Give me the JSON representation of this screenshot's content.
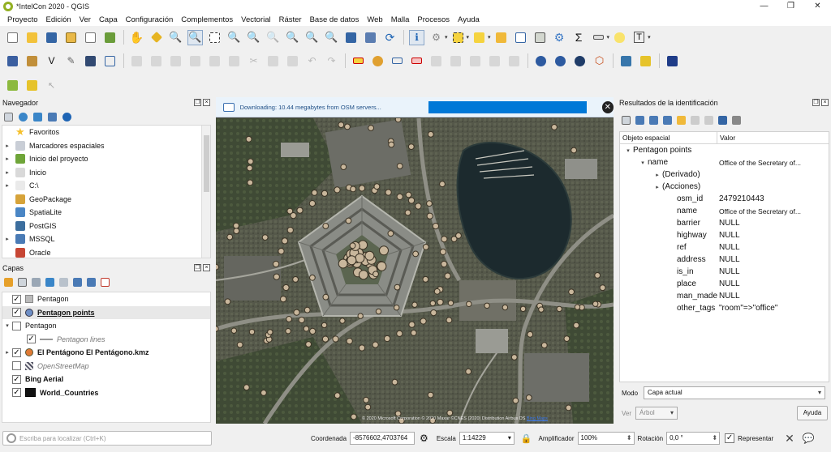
{
  "window": {
    "title": "*IntelCon 2020 - QGIS"
  },
  "menu": [
    "Proyecto",
    "Edición",
    "Ver",
    "Capa",
    "Configuración",
    "Complementos",
    "Vectorial",
    "Ráster",
    "Base de datos",
    "Web",
    "Malla",
    "Procesos",
    "Ayuda"
  ],
  "navigator": {
    "title": "Navegador",
    "items": [
      {
        "label": "Favoritos",
        "icon": "star-icon",
        "expand": false
      },
      {
        "label": "Marcadores espaciales",
        "icon": "bookmarks-icon",
        "expand": true
      },
      {
        "label": "Inicio del proyecto",
        "icon": "project-home-icon",
        "expand": true
      },
      {
        "label": "Inicio",
        "icon": "home-folder-icon",
        "expand": true
      },
      {
        "label": "C:\\",
        "icon": "drive-icon",
        "expand": true
      },
      {
        "label": "GeoPackage",
        "icon": "geopackage-icon",
        "expand": false
      },
      {
        "label": "SpatiaLite",
        "icon": "spatialite-icon",
        "expand": false
      },
      {
        "label": "PostGIS",
        "icon": "postgis-icon",
        "expand": false
      },
      {
        "label": "MSSQL",
        "icon": "mssql-icon",
        "expand": true
      },
      {
        "label": "Oracle",
        "icon": "oracle-icon",
        "expand": false
      }
    ]
  },
  "layers": {
    "title": "Capas",
    "items": [
      {
        "label": "Pentagon",
        "checked": true,
        "style": "normal",
        "indent": 0,
        "symbol": "gray-group",
        "expand": ""
      },
      {
        "label": "Pentagon points",
        "checked": true,
        "style": "selected",
        "indent": 0,
        "symbol": "blue-dot",
        "expand": ""
      },
      {
        "label": "Pentagon",
        "checked": false,
        "style": "normal",
        "indent": 0,
        "symbol": "none",
        "expand": "▾"
      },
      {
        "label": "Pentagon lines",
        "checked": true,
        "style": "italic",
        "indent": 1,
        "symbol": "line",
        "expand": ""
      },
      {
        "label": "El Pentágono El Pentágono.kmz",
        "checked": true,
        "style": "bold",
        "indent": 0,
        "symbol": "orange-dot",
        "expand": "▸"
      },
      {
        "label": "OpenStreetMap",
        "checked": false,
        "style": "italic",
        "indent": 0,
        "symbol": "osm-icon",
        "expand": ""
      },
      {
        "label": "Bing Aerial",
        "checked": true,
        "style": "bold",
        "indent": 0,
        "symbol": "none",
        "expand": ""
      },
      {
        "label": "World_Countries",
        "checked": true,
        "style": "bold",
        "indent": 0,
        "symbol": "black-fill",
        "expand": ""
      }
    ]
  },
  "map": {
    "banner_text": "Downloading: 10.44 megabytes from OSM servers...",
    "attribution_prefix": "© 2020 Microsoft Corporation © 2020 Maxar ©CNES (2020) Distribution Airbus DS ",
    "attribution_link": "Bing Maps"
  },
  "identify": {
    "title": "Resultados de la identificación",
    "col_feature": "Objeto espacial",
    "col_value": "Valor",
    "rows": [
      {
        "key": "Pentagon points",
        "value": "",
        "indent": 0,
        "arrow": "▾",
        "small": false
      },
      {
        "key": "name",
        "value": "Office of the Secretary of...",
        "indent": 1,
        "arrow": "▾",
        "small": true
      },
      {
        "key": "(Derivado)",
        "value": "",
        "indent": 2,
        "arrow": "▸",
        "small": false
      },
      {
        "key": "(Acciones)",
        "value": "",
        "indent": 2,
        "arrow": "▸",
        "small": false
      },
      {
        "key": "osm_id",
        "value": "2479210443",
        "indent": 3,
        "arrow": "",
        "small": false
      },
      {
        "key": "name",
        "value": "Office of the Secretary of...",
        "indent": 3,
        "arrow": "",
        "small": true
      },
      {
        "key": "barrier",
        "value": "NULL",
        "indent": 3,
        "arrow": "",
        "small": false
      },
      {
        "key": "highway",
        "value": "NULL",
        "indent": 3,
        "arrow": "",
        "small": false
      },
      {
        "key": "ref",
        "value": "NULL",
        "indent": 3,
        "arrow": "",
        "small": false
      },
      {
        "key": "address",
        "value": "NULL",
        "indent": 3,
        "arrow": "",
        "small": false
      },
      {
        "key": "is_in",
        "value": "NULL",
        "indent": 3,
        "arrow": "",
        "small": false
      },
      {
        "key": "place",
        "value": "NULL",
        "indent": 3,
        "arrow": "",
        "small": false
      },
      {
        "key": "man_made",
        "value": "NULL",
        "indent": 3,
        "arrow": "",
        "small": false
      },
      {
        "key": "other_tags",
        "value": "\"room\"=>\"office\"",
        "indent": 3,
        "arrow": "",
        "small": false
      }
    ],
    "mode_label": "Modo",
    "mode_value": "Capa actual",
    "view_label": "Ver",
    "view_value": "Árbol",
    "help_label": "Ayuda"
  },
  "status": {
    "locator_placeholder": "Escriba para localizar (Ctrl+K)",
    "coord_label": "Coordenada",
    "coord_value": "-8576602,4703764",
    "scale_label": "Escala",
    "scale_value": "1:14229",
    "magnifier_label": "Amplificador",
    "magnifier_value": "100%",
    "rotation_label": "Rotación",
    "rotation_value": "0,0 °",
    "render_label": "Representar"
  },
  "colors": {
    "accent": "#0078d7",
    "point_fill": "#c9b79c",
    "point_stroke": "#3b3325",
    "qgis_green": "#93b023"
  }
}
